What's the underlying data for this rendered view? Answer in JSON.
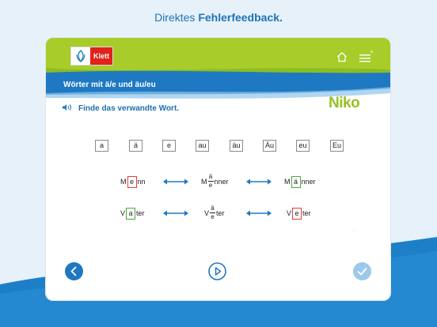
{
  "caption": {
    "prefix": "Direktes ",
    "bold": "Fehlerfeedback."
  },
  "header": {
    "logo_text": "Klett",
    "lesson_title": "Wörter mit ä/e und äu/eu",
    "brand": "Niko"
  },
  "task": {
    "instruction": "Finde das verwandte Wort."
  },
  "choices": [
    "a",
    "ä",
    "e",
    "au",
    "äu",
    "Äu",
    "eu",
    "Eu"
  ],
  "rows": [
    {
      "left": {
        "pre": "M",
        "slot": "e",
        "post": "nn",
        "state": "wrong"
      },
      "mid": {
        "pre": "M",
        "top": "ä",
        "bottom": "e",
        "post": "nner"
      },
      "right": {
        "pre": "M",
        "slot": "ä",
        "post": "nner",
        "state": "correct"
      }
    },
    {
      "left": {
        "pre": "V",
        "slot": "a",
        "post": "ter",
        "state": "correct"
      },
      "mid": {
        "pre": "V",
        "top": "ä",
        "bottom": "e",
        "post": "ter"
      },
      "right": {
        "pre": "V",
        "slot": "e",
        "post": "ter",
        "state": "wrong"
      }
    }
  ],
  "colors": {
    "accent_blue": "#1e78c2",
    "header_green": "#a8cc2a",
    "correct_green": "#49a83a",
    "wrong_red": "#e23c3c"
  },
  "icons": {
    "home": "home-icon",
    "menu": "menu-icon",
    "speaker": "speaker-icon",
    "back": "chevron-left-icon",
    "play": "play-icon",
    "check": "check-icon"
  }
}
